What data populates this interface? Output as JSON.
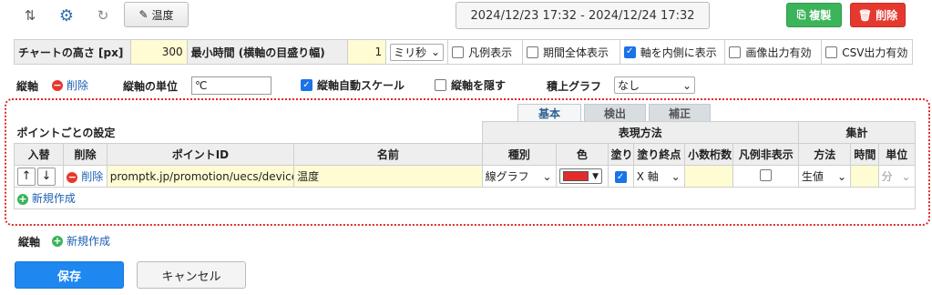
{
  "toolbar": {
    "temp_button": "温度",
    "date_range": "2024/12/23 17:32 - 2024/12/24 17:32",
    "duplicate": "複製",
    "delete": "削除"
  },
  "settings": {
    "chart_height_label": "チャートの高さ [px]",
    "chart_height_value": "300",
    "min_time_label": "最小時間 (横軸の目盛り幅)",
    "min_time_value": "1",
    "min_time_unit": "ミリ秒",
    "legend": "凡例表示",
    "full_period": "期間全体表示",
    "axis_inside": "軸を内側に表示",
    "image_output": "画像出力有効",
    "csv_output": "CSV出力有効"
  },
  "axis": {
    "label": "縦軸",
    "delete": "削除",
    "unit_label": "縦軸の単位",
    "unit_value": "℃",
    "auto_scale": "縦軸自動スケール",
    "hide_axis": "縦軸を隠す",
    "stack_label": "積上グラフ",
    "stack_value": "なし"
  },
  "tabs": [
    "基本",
    "検出",
    "補正"
  ],
  "points": {
    "section_title": "ポイントごとの設定",
    "group_expr": "表現方法",
    "group_agg": "集計",
    "headers": {
      "swap": "入替",
      "delete": "削除",
      "point_id": "ポイントID",
      "name": "名前",
      "type": "種別",
      "color": "色",
      "fill": "塗り",
      "fill_end": "塗り終点",
      "decimals": "小数桁数",
      "hide_legend": "凡例非表示",
      "method": "方法",
      "time": "時間",
      "unit": "単位"
    },
    "row": {
      "up": "↑",
      "down": "↓",
      "delete": "削除",
      "point_id": "promptk.jp/promotion/uecs/device",
      "name": "温度",
      "type": "線グラフ",
      "color": "#e32b2b",
      "fill_end": "X 軸",
      "decimals": "",
      "method": "生値",
      "time": "",
      "unit": "分"
    },
    "new": "新規作成"
  },
  "axis_footer": {
    "label": "縦軸",
    "new": "新規作成"
  },
  "actions": {
    "save": "保存",
    "cancel": "キャンセル"
  }
}
